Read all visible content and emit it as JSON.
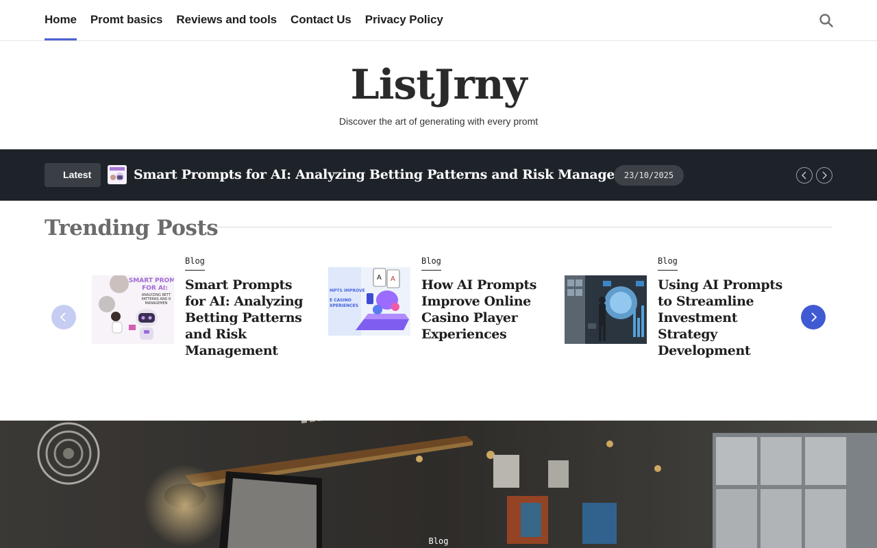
{
  "nav": {
    "items": [
      {
        "label": "Home",
        "active": true
      },
      {
        "label": "Promt basics",
        "active": false
      },
      {
        "label": "Reviews and tools",
        "active": false
      },
      {
        "label": "Contact Us",
        "active": false
      },
      {
        "label": "Privacy Policy",
        "active": false
      }
    ],
    "search_icon": "search-icon",
    "accent": "#4e5fd3"
  },
  "site": {
    "title": "ListJrny",
    "tagline": "Discover the art of generating with every promt"
  },
  "ticker": {
    "badge": "Latest",
    "title": "Smart Prompts for AI: Analyzing Betting Patterns and Risk Management",
    "date": "23/10/2025",
    "prev_icon": "chevron-left-icon",
    "next_icon": "chevron-right-icon",
    "background": "#1e2329"
  },
  "trending": {
    "heading": "Trending Posts",
    "posts": [
      {
        "category": "Blog",
        "title": "Smart Prompts for AI: Analyzing Betting Patterns and Risk Management",
        "thumb_text": "SMART PROMPTS FOR AI: ANALYZING BETTING PATTERNS AND RISK MANAGEMENT"
      },
      {
        "category": "Blog",
        "title": "How AI Prompts Improve Online Casino Player Experiences",
        "thumb_text": "AI PROMPTS IMPROVE CASINO PLAYER EXPERIENCES"
      },
      {
        "category": "Blog",
        "title": "Using AI Prompts to Streamline Investment Strategy Development",
        "thumb_text": ""
      }
    ],
    "prev_color": "#c6cdf3",
    "next_color": "#3f5ad3"
  },
  "hero": {
    "category": "Blog"
  }
}
